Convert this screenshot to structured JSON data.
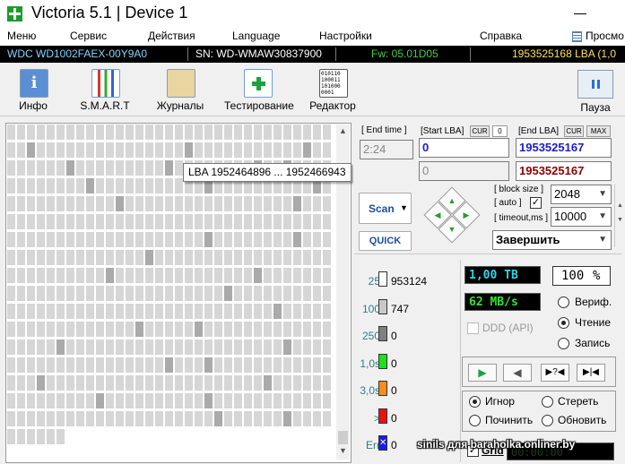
{
  "window": {
    "title": "Victoria 5.1 | Device 1"
  },
  "menu": {
    "items": [
      "Меню",
      "Сервис",
      "Действия",
      "Language",
      "Настройки",
      "Справка"
    ],
    "view_label": "Просмо"
  },
  "infobar": {
    "model": "WDC WD1002FAEX-00Y9A0",
    "serial": "SN: WD-WMAW30837900",
    "firmware": "Fw: 05.01D05",
    "lba": "1953525168 LBA (1,0",
    "colors": {
      "model": "#7fd3ff",
      "serial": "#ffffff",
      "firmware": "#3cd23c",
      "lba": "#ffe14d"
    }
  },
  "toolbar": {
    "info": "Инфо",
    "smart": "S.M.A.R.T",
    "logs": "Журналы",
    "test": "Тестирование",
    "editor": "Редактор",
    "pause": "Пауза",
    "editor_icon_text": "010110 100011 101000 0001"
  },
  "scanmap": {
    "tooltip": "LBA  1952464896 ... 1952466943",
    "scroll_up": "▲",
    "scroll_down": "▼"
  },
  "controls": {
    "end_time_label": "[ End time ]",
    "end_time_value": "2:24",
    "start_lba_label": "[Start LBA]",
    "cur_label": "CUR",
    "start_cur_value": "0",
    "end_lba_label": "[End LBA]",
    "max_label": "MAX",
    "start_lba_value": "0",
    "end_lba_value": "1953525167",
    "start_lba_value2": "0",
    "end_lba_value2": "1953525167",
    "scan_label": "Scan",
    "quick_label": "QUICK",
    "block_size_label": "[ block size ]",
    "auto_label": "[ auto ]",
    "auto_checked": "✓",
    "block_size_value": "2048",
    "timeout_label": "[ timeout,ms ]",
    "timeout_value": "10000",
    "action_value": "Завершить",
    "arrows": {
      "up": "▲",
      "left": "◀",
      "right": "▶",
      "down": "▼"
    }
  },
  "counters": [
    {
      "label": "25",
      "value": "953124",
      "color": "#ffffff"
    },
    {
      "label": "100",
      "value": "747",
      "color": "#c8c8c8"
    },
    {
      "label": "250",
      "value": "0",
      "color": "#808080"
    },
    {
      "label": "1,0s",
      "value": "0",
      "color": "#1ee01e"
    },
    {
      "label": "3,0s",
      "value": "0",
      "color": "#ff8c1a"
    },
    {
      "label": ">",
      "value": "0",
      "color": "#ee1010"
    },
    {
      "label": "Err",
      "value": "0",
      "color": "#1a1aee",
      "marker": "✕"
    }
  ],
  "status": {
    "progress_size": "1,00 TB",
    "progress_percent": "100",
    "percent_sign": "%",
    "speed": "62 MB/s",
    "ddd_label": "DDD (API)",
    "mode_verify": "Вериф.",
    "mode_read": "Чтение",
    "mode_write": "Запись",
    "selected_mode": "read",
    "play_icons": [
      "▶",
      "◀",
      "▶?◀",
      "▶|◀"
    ],
    "action_ignore": "Игнор",
    "action_erase": "Стереть",
    "action_repair": "Починить",
    "action_refresh": "Обновить",
    "selected_action": "ignore",
    "grid_label": "Grid",
    "grid_checked": "✓",
    "grid_timer": "00:00:00"
  },
  "watermark": "sinils для baraholka.onliner.by"
}
